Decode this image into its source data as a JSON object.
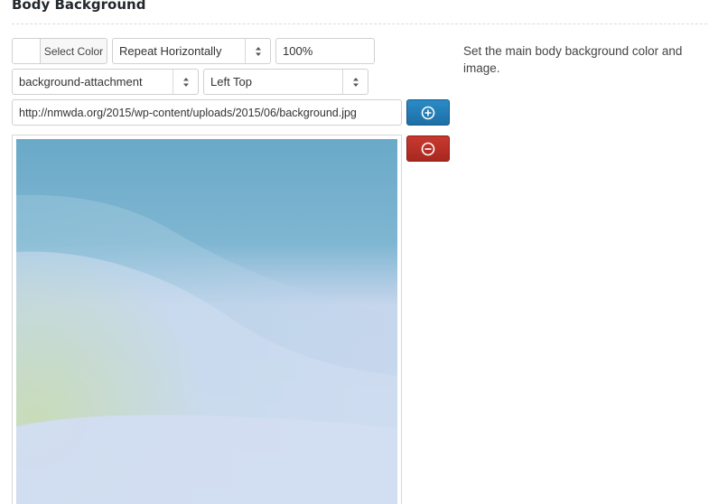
{
  "section": {
    "title": "Body Background"
  },
  "controls": {
    "color_button_label": "Select Color",
    "color_value": "#ffffff",
    "repeat_select": {
      "value": "Repeat Horizontally"
    },
    "size_input": {
      "value": "100%"
    },
    "attachment_select": {
      "value": "background-attachment"
    },
    "position_select": {
      "value": "Left Top"
    },
    "image_url_input": {
      "value": "http://nmwda.org/2015/wp-content/uploads/2015/06/background.jpg"
    },
    "add_button_icon": "plus-circle-icon",
    "remove_button_icon": "minus-circle-icon"
  },
  "description": "Set the main body background color and image.",
  "colors": {
    "add_button": "#2a8bc6",
    "remove_button": "#c8392f"
  }
}
